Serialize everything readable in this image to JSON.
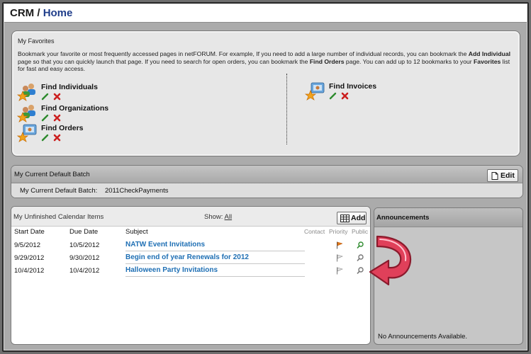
{
  "header": {
    "crm": "CRM",
    "separator": "/",
    "page": "Home"
  },
  "favorites": {
    "heading": "My Favorites",
    "description": {
      "p1": "Bookmark your favorite or most frequently accessed pages in netFORUM. For example, If you need to add a large number of individual records, you can bookmark the ",
      "b1": "Add Individual",
      "p2": " page so that you can quickly launch that page. If you need to search for open orders, you can bookmark the ",
      "b2": "Find Orders",
      "p3": " page. You can add up to 12 bookmarks to your ",
      "b3": "Favorites",
      "p4": " list for fast and easy access."
    },
    "items_left": [
      {
        "label": "Find Individuals"
      },
      {
        "label": "Find Organizations"
      },
      {
        "label": "Find Orders"
      }
    ],
    "items_right": [
      {
        "label": "Find Invoices"
      }
    ]
  },
  "batch": {
    "title": "My Current Default Batch",
    "edit_label": "Edit",
    "row_label": "My Current Default Batch:",
    "row_value": "2011CheckPayments"
  },
  "calendar": {
    "title": "My Unfinished Calendar Items",
    "show_label": "Show:",
    "show_value": "All",
    "add_label": "Add",
    "columns": {
      "start": "Start Date",
      "due": "Due Date",
      "subject": "Subject",
      "contact": "Contact",
      "priority": "Priority",
      "public": "Public"
    },
    "rows": [
      {
        "start": "9/5/2012",
        "due": "10/5/2012",
        "subject": "NATW Event Invitations"
      },
      {
        "start": "9/29/2012",
        "due": "9/30/2012",
        "subject": "Begin end of year Renewals for 2012"
      },
      {
        "start": "10/4/2012",
        "due": "10/4/2012",
        "subject": "Halloween Party Invitations"
      }
    ]
  },
  "announcements": {
    "title": "Announcements",
    "empty_text": "No Announcements Available."
  },
  "colors": {
    "link_blue": "#1e6fb4",
    "title_blue": "#1f3d8a",
    "arrow_pink": "#e0405a",
    "flag_orange": "#e07b1a",
    "edit_green": "#2e8b2e",
    "delete_red": "#cc1f1f"
  }
}
